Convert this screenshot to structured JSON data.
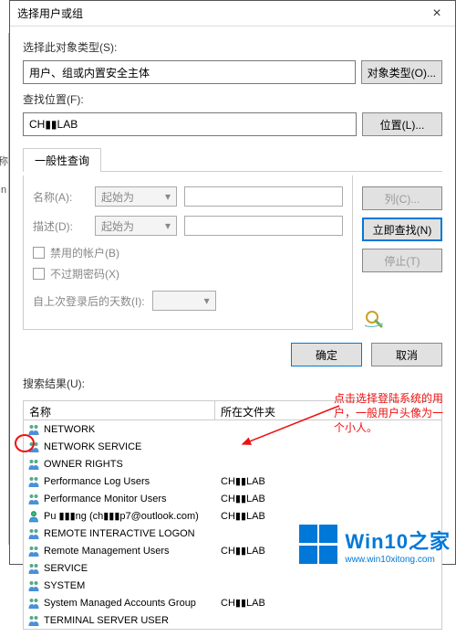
{
  "window": {
    "title": "选择用户或组",
    "close_label": "×"
  },
  "section": {
    "object_type_label": "选择此对象类型(S):",
    "object_type_value": "用户、组或内置安全主体",
    "object_type_btn": "对象类型(O)...",
    "location_label": "查找位置(F):",
    "location_value": "CH▮▮LAB",
    "location_btn": "位置(L)..."
  },
  "tab": {
    "common_query": "一般性查询"
  },
  "query": {
    "name_label": "名称(A):",
    "name_mode": "起始为",
    "desc_label": "描述(D):",
    "desc_mode": "起始为",
    "chk_disabled": "禁用的帐户(B)",
    "chk_noexpire": "不过期密码(X)",
    "days_label": "自上次登录后的天数(I):"
  },
  "rightbuttons": {
    "columns": "列(C)...",
    "findnow": "立即查找(N)",
    "stop": "停止(T)"
  },
  "footer": {
    "ok": "确定",
    "cancel": "取消"
  },
  "results": {
    "label": "搜索结果(U):",
    "col_name": "名称",
    "col_folder": "所在文件夹",
    "rows": [
      {
        "type": "group",
        "name": "NETWORK",
        "folder": ""
      },
      {
        "type": "group",
        "name": "NETWORK SERVICE",
        "folder": ""
      },
      {
        "type": "group",
        "name": "OWNER RIGHTS",
        "folder": ""
      },
      {
        "type": "group",
        "name": "Performance Log Users",
        "folder": "CH▮▮LAB"
      },
      {
        "type": "group",
        "name": "Performance Monitor Users",
        "folder": "CH▮▮LAB"
      },
      {
        "type": "user",
        "name": "Pu ▮▮▮ng (ch▮▮▮p7@outlook.com)",
        "folder": "CH▮▮LAB"
      },
      {
        "type": "group",
        "name": "REMOTE INTERACTIVE LOGON",
        "folder": ""
      },
      {
        "type": "group",
        "name": "Remote Management Users",
        "folder": "CH▮▮LAB"
      },
      {
        "type": "group",
        "name": "SERVICE",
        "folder": ""
      },
      {
        "type": "group",
        "name": "SYSTEM",
        "folder": ""
      },
      {
        "type": "group",
        "name": "System Managed Accounts Group",
        "folder": "CH▮▮LAB"
      },
      {
        "type": "group",
        "name": "TERMINAL SERVER USER",
        "folder": ""
      }
    ]
  },
  "annotations": {
    "callout": "点击选择登陆系统的用户，一般用户头像为一个小人。"
  },
  "watermark": {
    "brand": "Win10之家",
    "url": "www.win10xitong.com"
  },
  "left_stub": {
    "a": "称",
    "b": "In"
  }
}
